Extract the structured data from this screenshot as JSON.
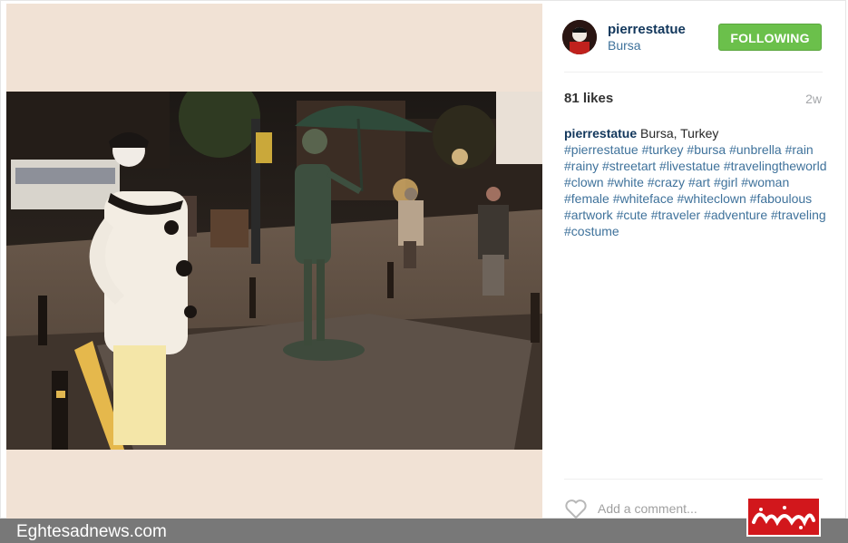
{
  "post": {
    "username": "pierrestatue",
    "location": "Bursa",
    "follow_label": "FOLLOWING",
    "likes": "81 likes",
    "time_ago": "2w",
    "caption_user": "pierrestatue",
    "caption_text": " Bursa, Turkey",
    "hashtags": "#pierrestatue #turkey #bursa #unbrella #rain #rainy #streetart #livestatue #travelingtheworld #clown #white #crazy #art #girl #woman #female #whiteface #whiteclown #faboulous #artwork #cute #traveler #adventure #traveling #costume",
    "comment_placeholder": "Add a comment..."
  },
  "watermark": {
    "site": "Eghtesadnews.com",
    "logo_text": "اقتصادنیوز"
  },
  "colors": {
    "follow_green": "#6bc04b",
    "username_blue": "#12375c",
    "link_blue": "#3f729b",
    "logo_red": "#d2171c"
  },
  "icons": {
    "heart": "heart-icon"
  }
}
